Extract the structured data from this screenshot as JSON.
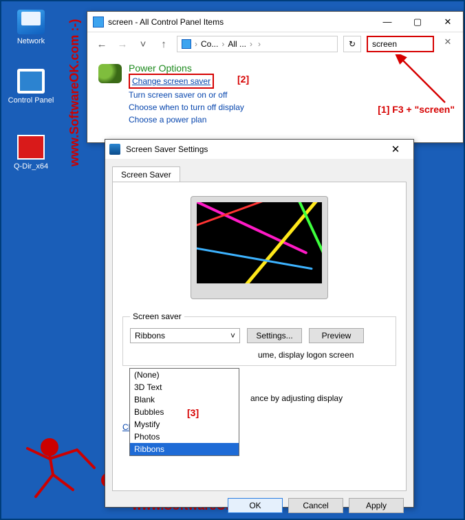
{
  "desktop": {
    "icons": [
      {
        "name": "Network"
      },
      {
        "name": "Control Panel"
      },
      {
        "name": "Q-Dir_x64"
      }
    ]
  },
  "watermark": {
    "text": "www.SoftwareOK.com :-)"
  },
  "explorer": {
    "title": "screen - All Control Panel Items",
    "breadcrumb": [
      "Co...",
      "All ..."
    ],
    "search_value": "screen",
    "results": {
      "heading": "Power Options",
      "link_primary": "Change screen saver",
      "links": [
        "Turn screen saver on or off",
        "Choose when to turn off display",
        "Choose a power plan"
      ]
    }
  },
  "annotations": {
    "a1": "[1] F3 + \"screen\"",
    "a2": "[2]",
    "a3": "[3]"
  },
  "dialog": {
    "title": "Screen Saver Settings",
    "tab": "Screen Saver",
    "group_label": "Screen saver",
    "dropdown_selected": "Ribbons",
    "dropdown_items": [
      "(None)",
      "3D Text",
      "Blank",
      "Bubbles",
      "Mystify",
      "Photos",
      "Ribbons"
    ],
    "btn_settings": "Settings...",
    "btn_preview": "Preview",
    "partial_resume": "ume, display logon screen",
    "partial_power": "ance by adjusting display",
    "link_power": "Change power settings",
    "btn_ok": "OK",
    "btn_cancel": "Cancel",
    "btn_apply": "Apply"
  }
}
